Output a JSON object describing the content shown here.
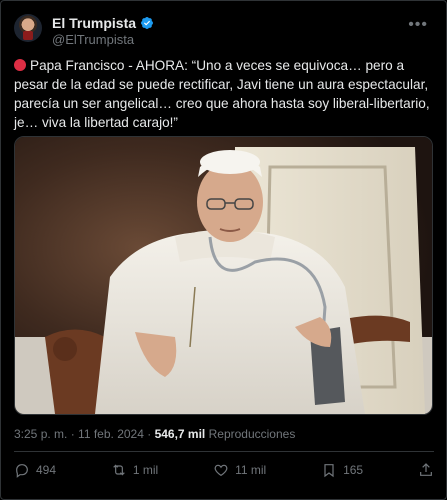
{
  "author": {
    "name": "El Trumpista",
    "handle": "@ElTrumpista",
    "more_icon": "more-icon",
    "verified_icon": "verified-badge-icon"
  },
  "tweet": {
    "status_emoji": "red-circle-icon",
    "text": "Papa Francisco - AHORA: “Uno a veces se equivoca… pero a pesar de la edad se puede rectificar, Javi tiene un aura espectacular, parecía un ser angelical… creo que ahora hasta soy liberal-libertario, je… viva la libertad carajo!”"
  },
  "meta": {
    "time": "3:25 p. m.",
    "separator": " · ",
    "date": "11 feb. 2024",
    "views_count": "546,7 mil",
    "views_label": "Reproducciones"
  },
  "actions": {
    "replies": "494",
    "reposts": "1 mil",
    "likes": "11 mil",
    "bookmarks": "165"
  },
  "colors": {
    "background": "#000000",
    "text": "#e7e9ea",
    "secondary": "#71767b",
    "verified": "#1d9bf0",
    "border": "#2f3336"
  }
}
